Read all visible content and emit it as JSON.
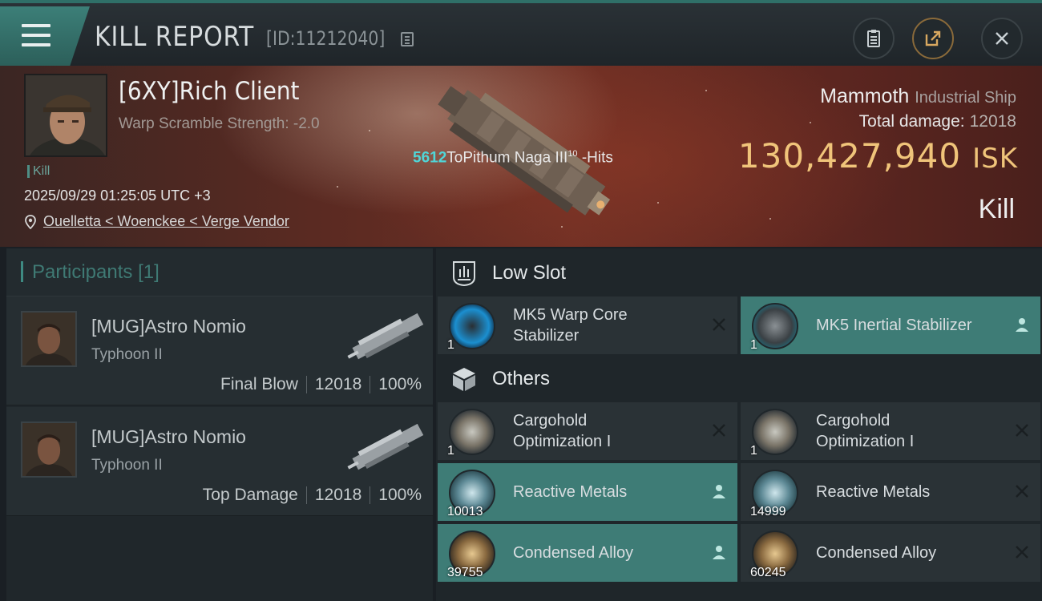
{
  "header": {
    "title": "KILL REPORT",
    "report_id": "[ID:11212040]"
  },
  "victim": {
    "name": "[6XY]Rich Client",
    "scramble": "Warp Scramble Strength: -2.0",
    "tag": "Kill",
    "datetime": "2025/09/29 01:25:05 UTC +3",
    "location": "Ouelletta < Woenckee < Verge Vendor"
  },
  "hits": {
    "count": "5612",
    "text": "ToPithum Naga III",
    "sup": "10",
    "suffix": " -Hits"
  },
  "ship": {
    "name": "Mammoth",
    "class": "Industrial Ship",
    "total_damage_label": "Total damage:",
    "total_damage": "12018",
    "isk_value": "130,427,940",
    "isk_unit": "ISK",
    "result": "Kill"
  },
  "participants": {
    "label": "Participants",
    "count": "[1]",
    "list": [
      {
        "name": "[MUG]Astro Nomio",
        "ship": "Typhoon II",
        "role": "Final Blow",
        "damage": "12018",
        "pct": "100%"
      },
      {
        "name": "[MUG]Astro Nomio",
        "ship": "Typhoon II",
        "role": "Top Damage",
        "damage": "12018",
        "pct": "100%"
      }
    ]
  },
  "low_slot": {
    "label": "Low Slot",
    "items": [
      {
        "line1": "MK5 Warp Core",
        "line2": "Stabilizer",
        "qty": "1",
        "status": "destroyed",
        "icon": "warp-core-stabilizer-icon"
      },
      {
        "line1": "MK5 Inertial Stabilizer",
        "line2": "",
        "qty": "1",
        "status": "dropped",
        "icon": "inertial-stabilizer-icon"
      }
    ]
  },
  "others": {
    "label": "Others",
    "items": [
      {
        "line1": "Cargohold",
        "line2": "Optimization I",
        "qty": "1",
        "status": "destroyed",
        "icon": "cargohold-icon"
      },
      {
        "line1": "Cargohold",
        "line2": "Optimization I",
        "qty": "1",
        "status": "destroyed",
        "icon": "cargohold-icon"
      },
      {
        "line1": "Reactive Metals",
        "line2": "",
        "qty": "10013",
        "status": "dropped",
        "icon": "reactive-metals-icon"
      },
      {
        "line1": "Reactive Metals",
        "line2": "",
        "qty": "14999",
        "status": "destroyed",
        "icon": "reactive-metals-icon"
      },
      {
        "line1": "Condensed Alloy",
        "line2": "",
        "qty": "39755",
        "status": "dropped",
        "icon": "condensed-alloy-icon"
      },
      {
        "line1": "Condensed Alloy",
        "line2": "",
        "qty": "60245",
        "status": "destroyed",
        "icon": "condensed-alloy-icon"
      }
    ]
  },
  "colors": {
    "accent": "#3e7c76",
    "isk": "#f0c47a",
    "hits": "#4fd6d8"
  }
}
